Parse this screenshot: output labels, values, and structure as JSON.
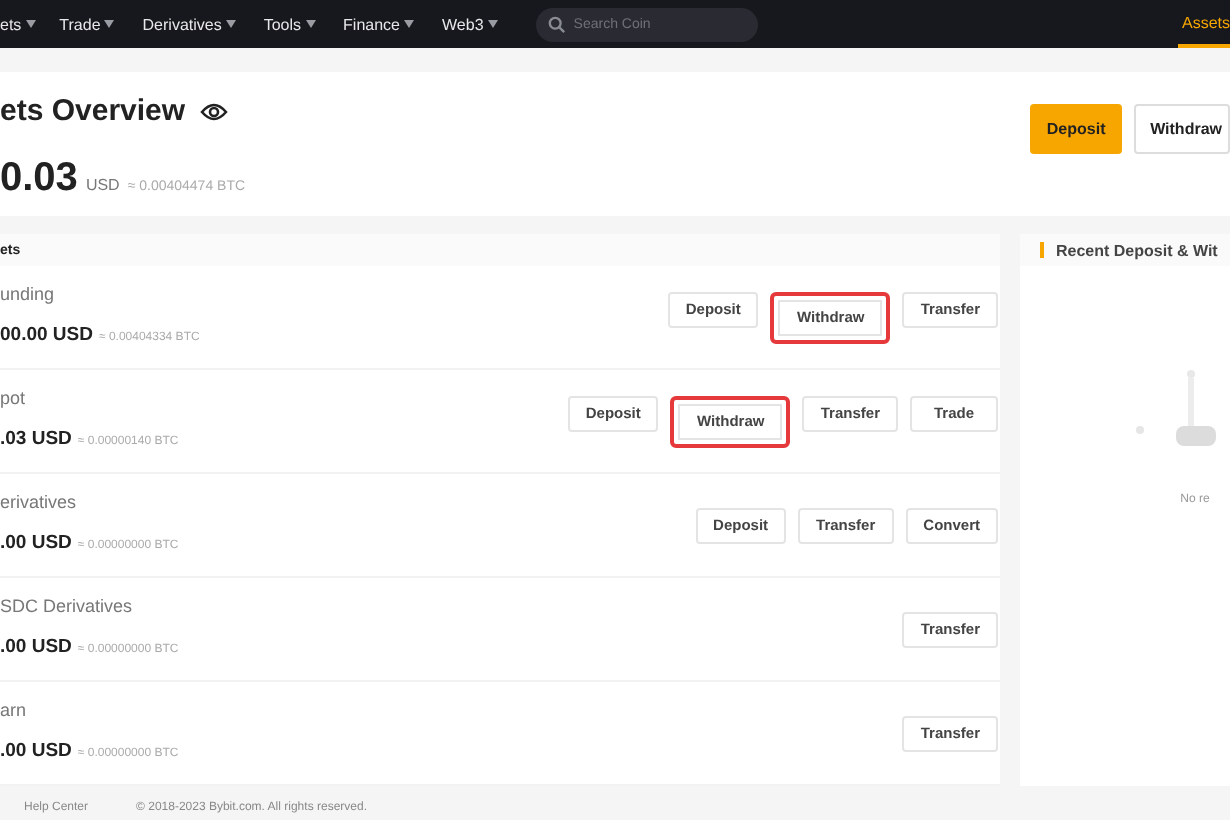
{
  "nav": {
    "items": [
      {
        "label": "ets"
      },
      {
        "label": "Trade"
      },
      {
        "label": "Derivatives"
      },
      {
        "label": "Tools"
      },
      {
        "label": "Finance"
      },
      {
        "label": "Web3"
      }
    ],
    "search": {
      "placeholder": "Search Coin"
    },
    "right_item": {
      "label": "Assets",
      "selected": true
    }
  },
  "overview": {
    "title": "ets Overview",
    "balance": "0.03",
    "currency": "USD",
    "btc": "≈ 0.00404474 BTC",
    "buttons": [
      {
        "label": "Deposit",
        "kind": "primary"
      },
      {
        "label": "Withdraw",
        "kind": "secondary"
      }
    ]
  },
  "accounts": {
    "title": "ets",
    "rows": [
      {
        "name": "unding",
        "amount": "00.00 USD",
        "btc": "≈ 0.00404334 BTC",
        "buttons": [
          {
            "label": "Deposit",
            "highlighted": false
          },
          {
            "label": "Withdraw",
            "highlighted": true
          },
          {
            "label": "Transfer",
            "highlighted": false
          }
        ]
      },
      {
        "name": "pot",
        "amount": ".03 USD",
        "btc": "≈ 0.00000140 BTC",
        "buttons": [
          {
            "label": "Deposit",
            "highlighted": false
          },
          {
            "label": "Withdraw",
            "highlighted": true
          },
          {
            "label": "Transfer",
            "highlighted": false
          },
          {
            "label": "Trade",
            "highlighted": false
          }
        ]
      },
      {
        "name": "erivatives",
        "amount": ".00 USD",
        "btc": "≈ 0.00000000 BTC",
        "buttons": [
          {
            "label": "Deposit",
            "highlighted": false
          },
          {
            "label": "Transfer",
            "highlighted": false
          },
          {
            "label": "Convert",
            "highlighted": false
          }
        ]
      },
      {
        "name": "SDC Derivatives",
        "amount": ".00 USD",
        "btc": "≈ 0.00000000 BTC",
        "buttons": [
          {
            "label": "Transfer",
            "highlighted": false
          }
        ]
      },
      {
        "name": "arn",
        "amount": ".00 USD",
        "btc": "≈ 0.00000000 BTC",
        "buttons": [
          {
            "label": "Transfer",
            "highlighted": false
          }
        ]
      }
    ]
  },
  "recent": {
    "title": "Recent Deposit & Wit",
    "empty_text": "No re"
  },
  "footer": {
    "links": [
      "Help Center"
    ],
    "copyright": "© 2018-2023 Bybit.com. All rights reserved."
  }
}
